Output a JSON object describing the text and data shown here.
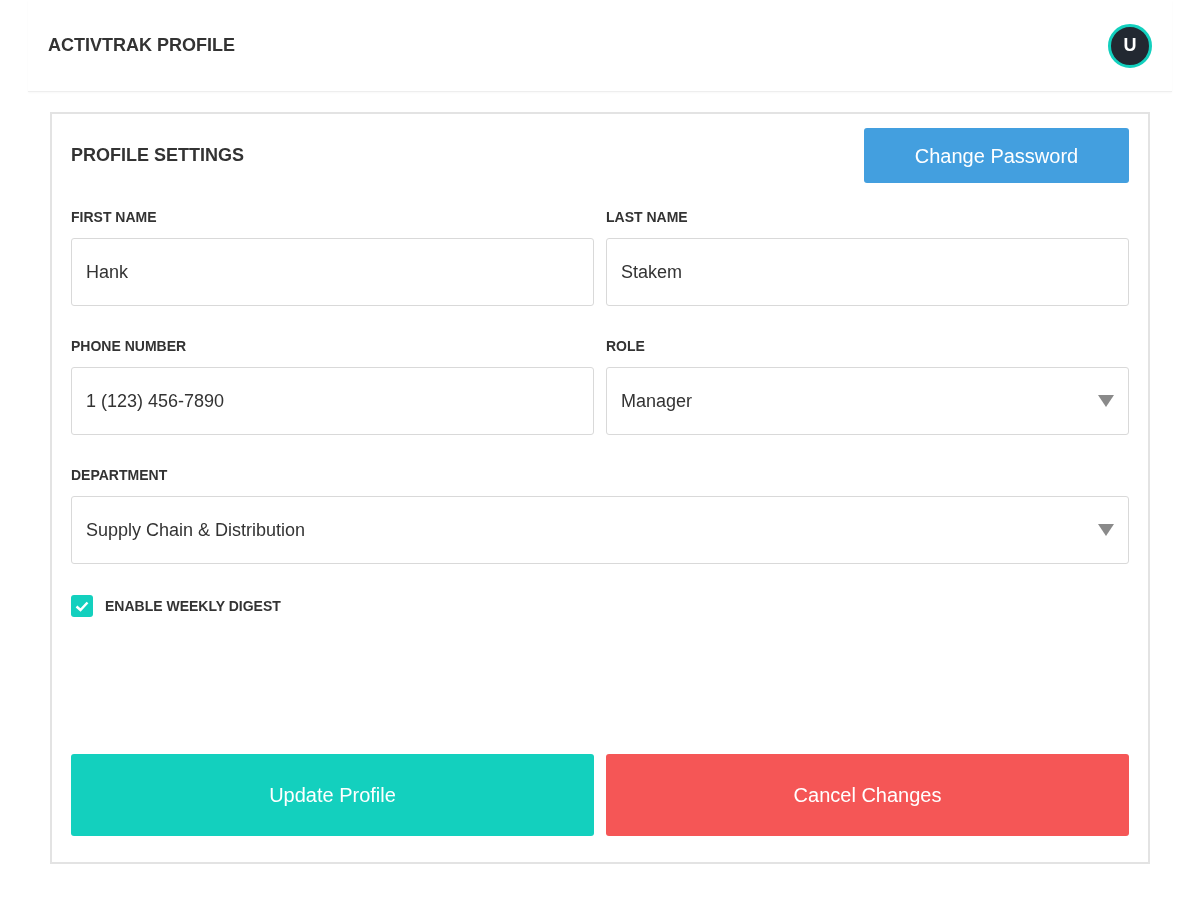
{
  "header": {
    "title": "ACTIVTRAK PROFILE",
    "avatar": "U"
  },
  "panel": {
    "title": "PROFILE SETTINGS",
    "action": "Change Password",
    "rows": [
      [
        {
          "label": "FIRST NAME",
          "kind": "text",
          "value": "Hank"
        },
        {
          "label": "LAST NAME",
          "kind": "text",
          "value": "Stakem"
        }
      ],
      [
        {
          "label": "PHONE NUMBER",
          "kind": "text",
          "value": "1 (123) 456-7890"
        },
        {
          "label": "ROLE",
          "kind": "select",
          "value": "Manager"
        }
      ],
      [
        {
          "label": "DEPARTMENT",
          "kind": "select",
          "value": "Supply Chain & Distribution"
        }
      ]
    ],
    "checkbox": {
      "label": "ENABLE WEEKLY DIGEST",
      "checked": true
    },
    "buttons": [
      {
        "label": "Update Profile",
        "kind": "primary"
      },
      {
        "label": "Cancel Changes",
        "kind": "danger"
      }
    ]
  }
}
